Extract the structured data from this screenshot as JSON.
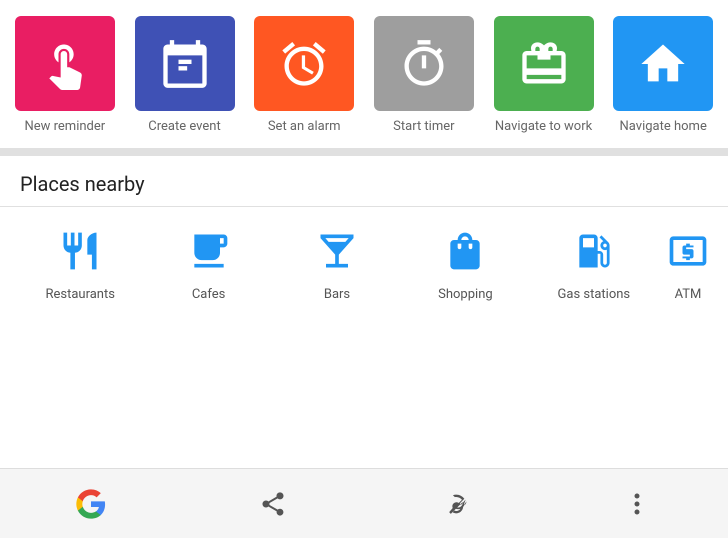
{
  "quick_actions": {
    "items": [
      {
        "id": "new-reminder",
        "label": "New reminder",
        "color_class": "bg-pink",
        "icon": "reminder"
      },
      {
        "id": "create-event",
        "label": "Create event",
        "color_class": "bg-indigo",
        "icon": "calendar"
      },
      {
        "id": "set-alarm",
        "label": "Set an alarm",
        "color_class": "bg-orange",
        "icon": "alarm"
      },
      {
        "id": "start-timer",
        "label": "Start timer",
        "color_class": "bg-gray",
        "icon": "timer"
      },
      {
        "id": "navigate-work",
        "label": "Navigate to work",
        "color_class": "bg-green",
        "icon": "work"
      },
      {
        "id": "navigate-home",
        "label": "Navigate home",
        "color_class": "bg-blue",
        "icon": "home"
      }
    ]
  },
  "places_nearby": {
    "title": "Places nearby",
    "items": [
      {
        "id": "restaurants",
        "label": "Restaurants",
        "icon": "restaurant"
      },
      {
        "id": "cafes",
        "label": "Cafes",
        "icon": "cafe"
      },
      {
        "id": "bars",
        "label": "Bars",
        "icon": "bar"
      },
      {
        "id": "shopping",
        "label": "Shopping",
        "icon": "shopping"
      },
      {
        "id": "gas-stations",
        "label": "Gas stations",
        "icon": "gas"
      },
      {
        "id": "atm",
        "label": "ATM",
        "icon": "atm"
      }
    ]
  },
  "bottom_bar": {
    "items": [
      {
        "id": "google",
        "label": "Google"
      },
      {
        "id": "share",
        "label": "Share"
      },
      {
        "id": "touch",
        "label": "Touch"
      },
      {
        "id": "more",
        "label": "More options"
      }
    ]
  }
}
